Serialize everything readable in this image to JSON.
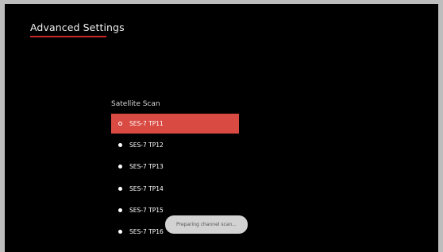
{
  "header": {
    "title": "Advanced Settings",
    "accent_color": "#c62828"
  },
  "section": {
    "label": "Satellite Scan"
  },
  "scan_list": {
    "selected_color": "#d94a43",
    "items": [
      {
        "label": "SES-7 TP11",
        "selected": true
      },
      {
        "label": "SES-7 TP12",
        "selected": false
      },
      {
        "label": "SES-7 TP13",
        "selected": false
      },
      {
        "label": "SES-7 TP14",
        "selected": false
      },
      {
        "label": "SES-7 TP15",
        "selected": false
      },
      {
        "label": "SES-7 TP16",
        "selected": false
      }
    ]
  },
  "toast": {
    "text": "Preparing channel scan..."
  }
}
